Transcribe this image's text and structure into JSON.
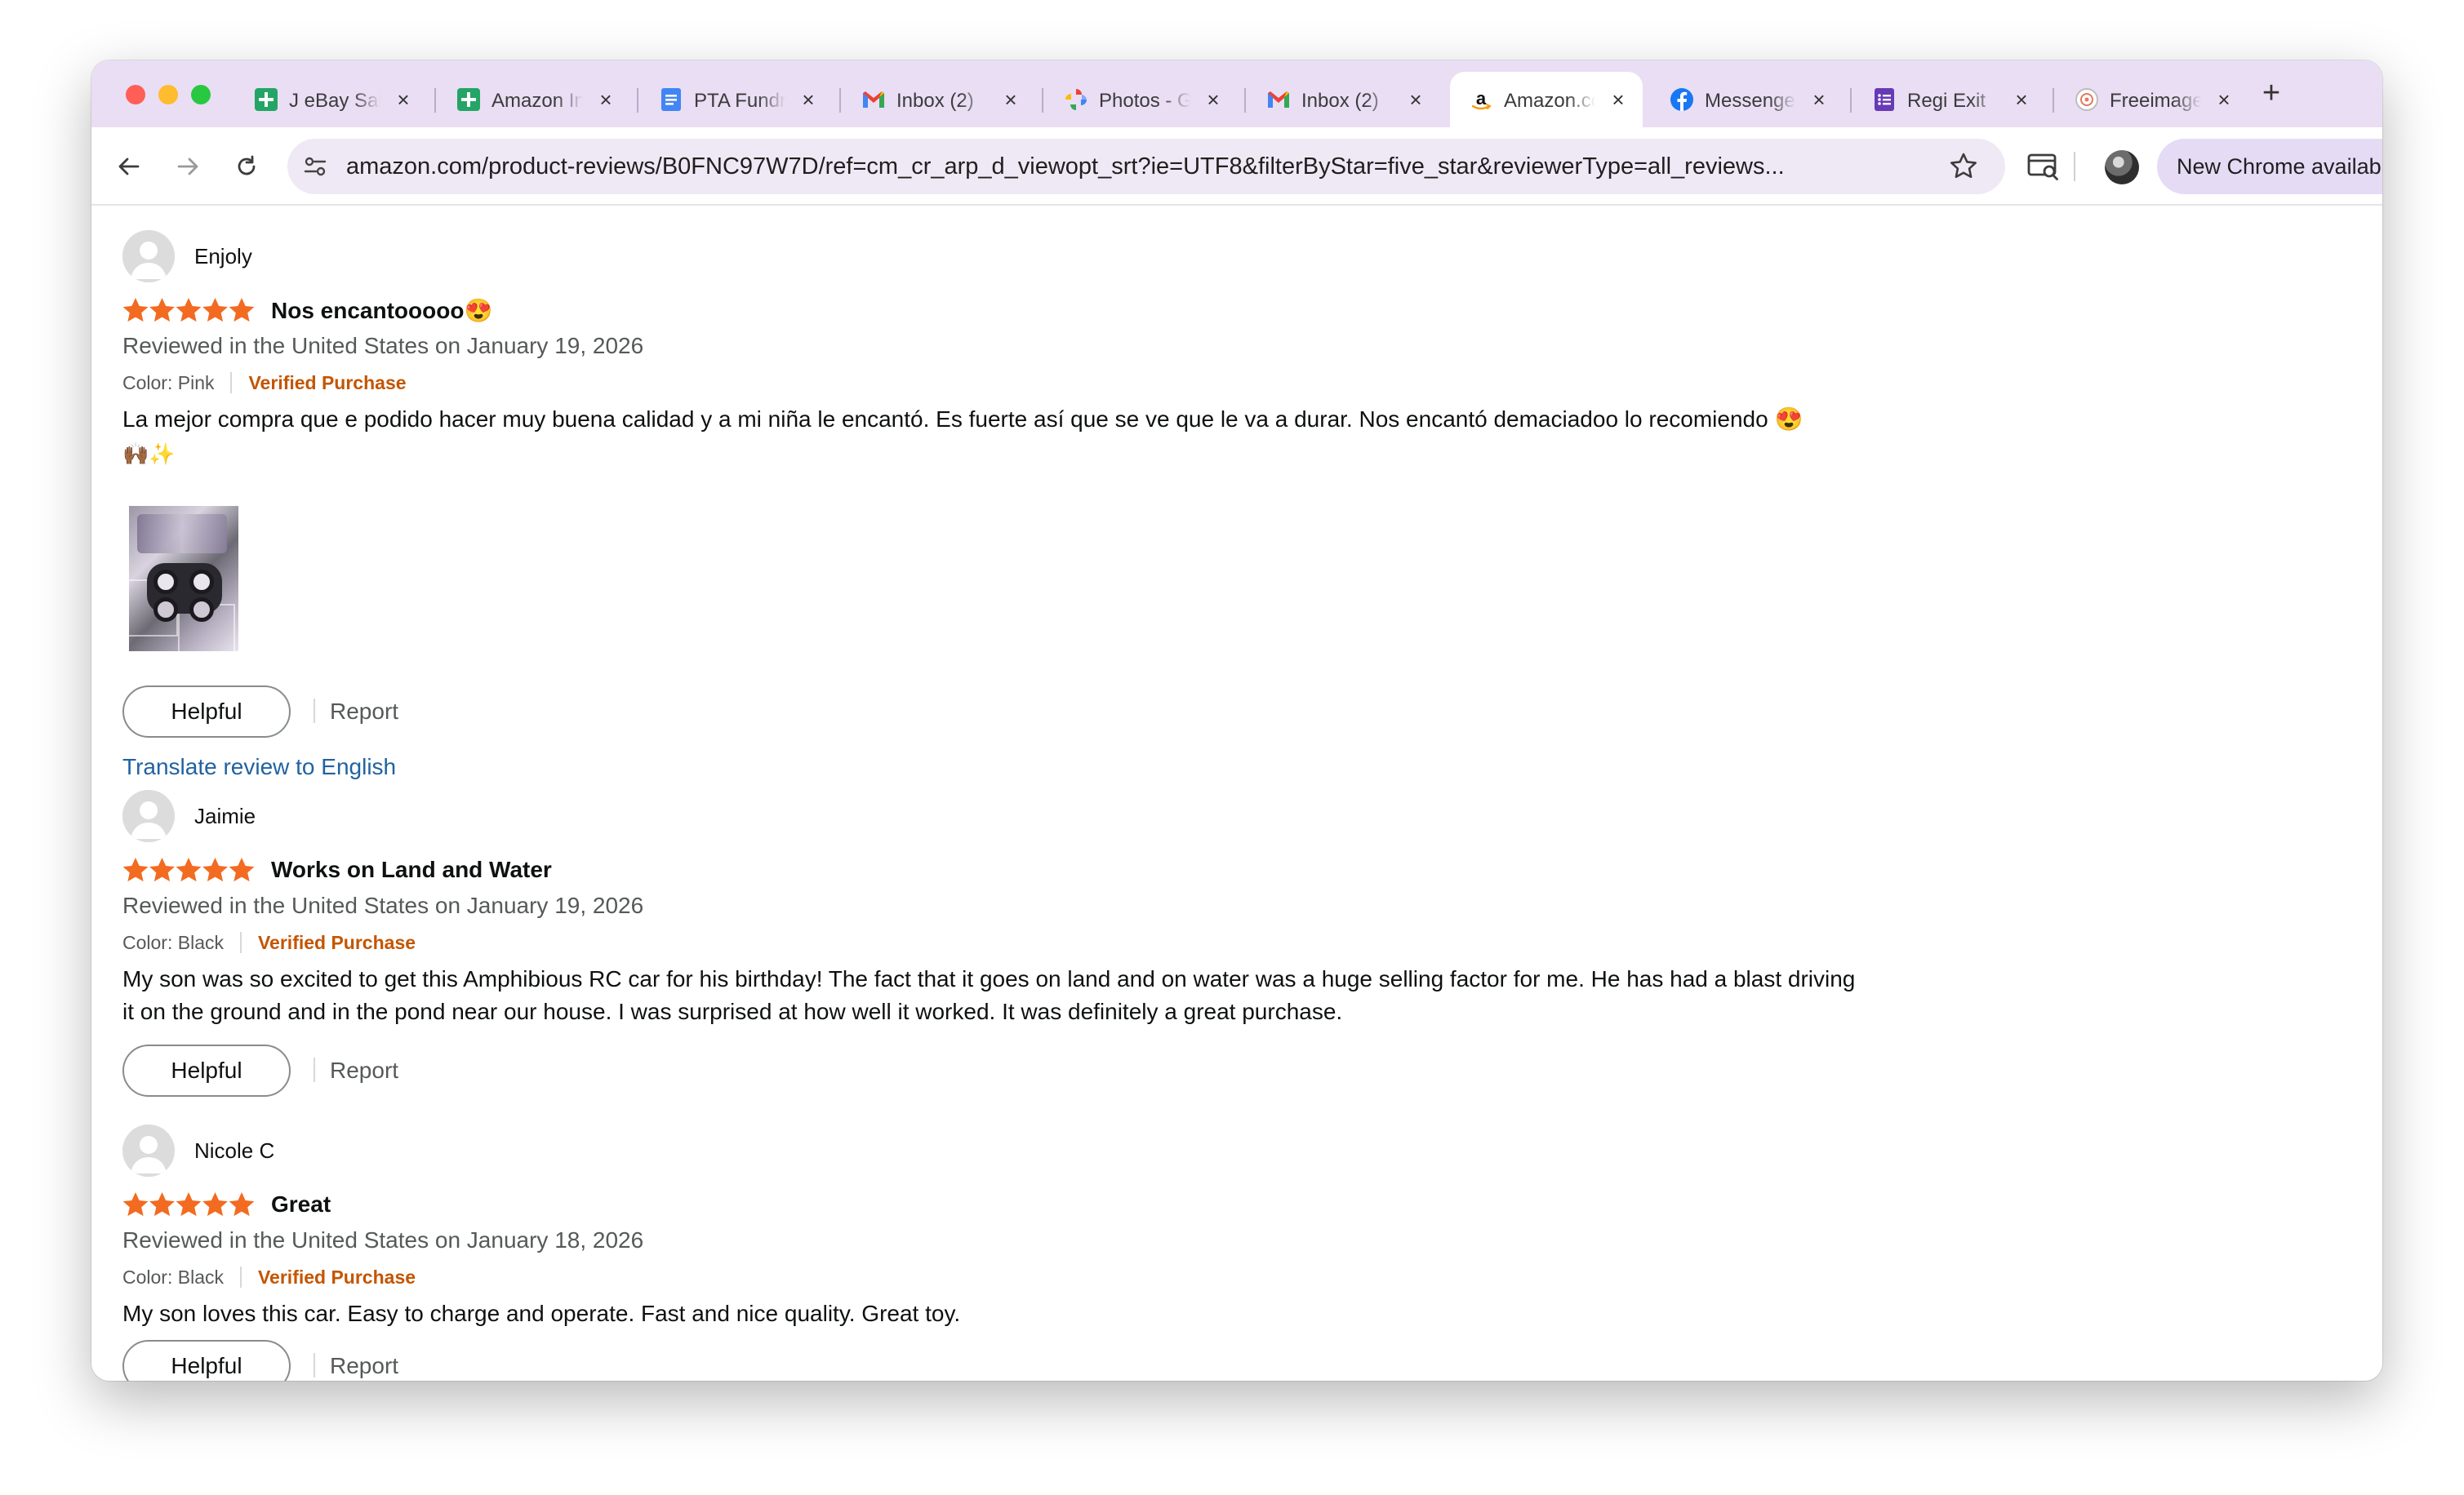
{
  "browser": {
    "tabs": [
      {
        "label": "J eBay Sales",
        "icon": "sheets-icon"
      },
      {
        "label": "Amazon Inventory",
        "icon": "sheets-icon"
      },
      {
        "label": "PTA Fundraiser",
        "icon": "docs-icon"
      },
      {
        "label": "Inbox (2)",
        "icon": "gmail-icon"
      },
      {
        "label": "Photos - Google",
        "icon": "photos-icon"
      },
      {
        "label": "Inbox (2)",
        "icon": "gmail-icon"
      },
      {
        "label": "Amazon.com",
        "icon": "amazon-icon",
        "active": true
      },
      {
        "label": "Messenger",
        "icon": "facebook-icon"
      },
      {
        "label": "Regi Exit",
        "icon": "forms-icon"
      },
      {
        "label": "Freeimages",
        "icon": "freeimages-icon"
      }
    ],
    "url": "amazon.com/product-reviews/B0FNC97W7D/ref=cm_cr_arp_d_viewopt_srt?ie=UTF8&filterByStar=five_star&reviewerType=all_reviews...",
    "update_label": "New Chrome available"
  },
  "reviews": [
    {
      "name": "Enjoly",
      "rating": 5,
      "title": "Nos encantooooo😍",
      "date": "Reviewed in the United States on January 19, 2026",
      "color": "Color: Pink",
      "verified": "Verified Purchase",
      "body": "La mejor compra que e podido hacer muy buena calidad y a mi niña le encantó. Es fuerte así que se ve que le va a durar. Nos encantó demaciadoo lo recomiendo 😍",
      "body_line2": "🙌🏾✨",
      "helpful": "Helpful",
      "report": "Report",
      "translate": "Translate review to English"
    },
    {
      "name": "Jaimie",
      "rating": 5,
      "title": "Works on Land and Water",
      "date": "Reviewed in the United States on January 19, 2026",
      "color": "Color: Black",
      "verified": "Verified Purchase",
      "body": "My son was so excited to get this Amphibious RC car for his birthday! The fact that it goes on land and on water was a huge selling factor for me. He has had a blast driving it on the ground and in the pond near our house. I was surprised at how well it worked. It was definitely a great purchase.",
      "helpful": "Helpful",
      "report": "Report"
    },
    {
      "name": "Nicole C",
      "rating": 5,
      "title": "Great",
      "date": "Reviewed in the United States on January 18, 2026",
      "color": "Color: Black",
      "verified": "Verified Purchase",
      "body": "My son loves this car. Easy to charge and operate. Fast and nice quality. Great toy.",
      "helpful": "Helpful",
      "report": "Report"
    }
  ],
  "colors": {
    "tabstrip": "#e9def4",
    "star": "#f26b21",
    "verified": "#c45500",
    "link": "#2162a1"
  }
}
